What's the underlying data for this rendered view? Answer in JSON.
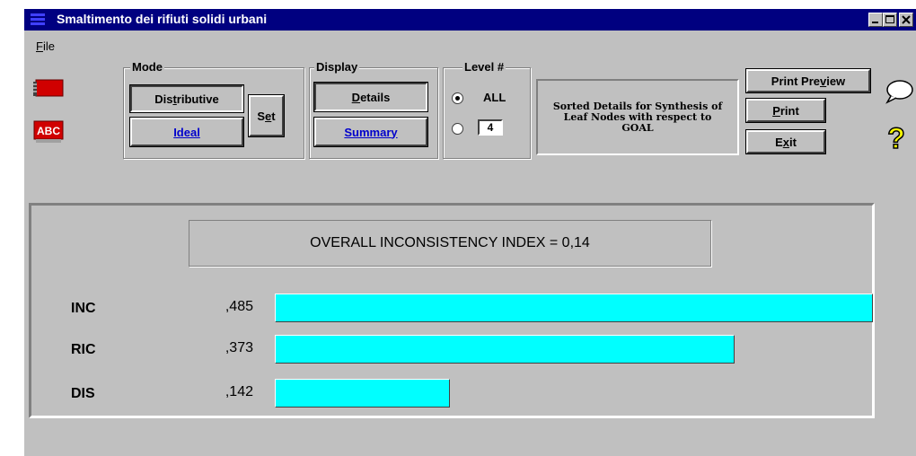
{
  "window": {
    "title": "Smaltimento dei rifiuti solidi urbani"
  },
  "menu": {
    "file": "File"
  },
  "mode": {
    "label": "Mode",
    "distributive": "Distributive",
    "ideal": "Ideal",
    "set": "Set"
  },
  "display": {
    "label": "Display",
    "details": "Details",
    "summary": "Summary"
  },
  "level": {
    "label": "Level #",
    "all": "ALL",
    "number": "4",
    "selected": "ALL"
  },
  "description": "Sorted Details for Synthesis of Leaf Nodes with respect to GOAL",
  "actions": {
    "print_preview": "Print Preview",
    "print": "Print",
    "exit": "Exit"
  },
  "inconsistency": "OVERALL INCONSISTENCY INDEX =  0,14",
  "rows": [
    {
      "label": "INC",
      "value": ",485",
      "fraction": 0.485
    },
    {
      "label": "RIC",
      "value": ",373",
      "fraction": 0.373
    },
    {
      "label": "DIS",
      "value": ",142",
      "fraction": 0.142
    }
  ],
  "colors": {
    "bar": "#00ffff",
    "titlebar": "#000080",
    "link": "#0000cc"
  },
  "icons": [
    "book-icon",
    "abc-icon",
    "speech-bubble-icon",
    "help-question-icon"
  ]
}
